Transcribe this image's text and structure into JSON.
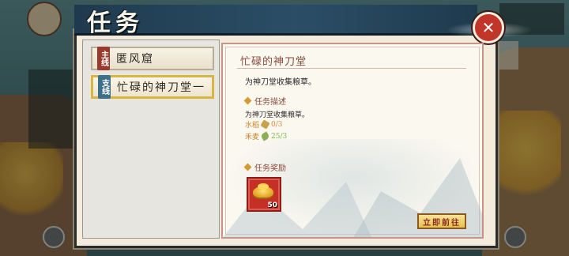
{
  "dialog": {
    "title": "任务",
    "close_icon": "close-icon"
  },
  "quest_list": [
    {
      "tag": "主线",
      "tag_kind": "main",
      "name": "匿风窟",
      "active": false
    },
    {
      "tag": "支线",
      "tag_kind": "side",
      "name": "忙碌的神刀堂一",
      "active": true
    }
  ],
  "detail": {
    "title": "忙碌的神刀堂",
    "summary": "为神刀堂收集粮草。",
    "description_header": "任务描述",
    "description": "为神刀堂收集粮草。",
    "requirements": [
      {
        "name": "水稻",
        "icon": "rice-icon",
        "progress": "0/3"
      },
      {
        "name": "禾麦",
        "icon": "wheat-icon",
        "progress": "25/3"
      }
    ],
    "reward_header": "任务奖励",
    "rewards": [
      {
        "icon": "gold-ingot-icon",
        "count": "50"
      }
    ],
    "go_button": "立即前往"
  },
  "colors": {
    "header_blue": "#1f3a4d",
    "close_red": "#c2362a",
    "title_brown": "#8a4a3a",
    "highlight_gold": "#d8b640"
  }
}
